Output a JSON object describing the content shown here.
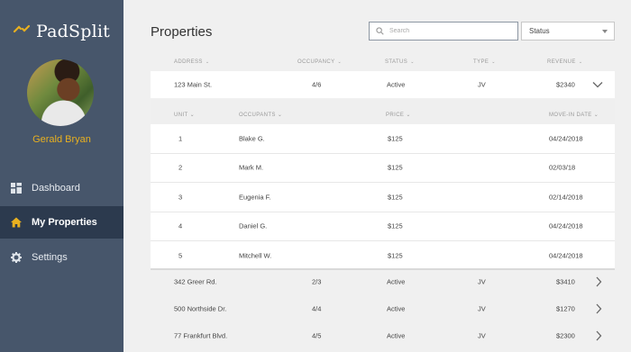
{
  "brand": {
    "name": "PadSplit",
    "accent": "#e8b020"
  },
  "user": {
    "name": "Gerald Bryan"
  },
  "nav": [
    {
      "label": "Dashboard",
      "icon": "dashboard-icon",
      "active": false
    },
    {
      "label": "My Properties",
      "icon": "home-icon",
      "active": true
    },
    {
      "label": "Settings",
      "icon": "gear-icon",
      "active": false
    }
  ],
  "page": {
    "title": "Properties"
  },
  "search": {
    "placeholder": "Search"
  },
  "status_filter": {
    "value": "Status"
  },
  "columns": {
    "address": "ADDRESS",
    "occupancy": "OCCUPANCY",
    "status": "STATUS",
    "type": "TYPE",
    "revenue": "REVENUE"
  },
  "sub_columns": {
    "unit": "UNIT",
    "occupants": "OCCUPANTS",
    "price": "PRICE",
    "move_in": "MOVE-IN DATE"
  },
  "properties": [
    {
      "address": "123 Main St.",
      "occupancy": "4/6",
      "status": "Active",
      "type": "JV",
      "revenue": "$2340",
      "expanded": true
    },
    {
      "address": "342 Greer Rd.",
      "occupancy": "2/3",
      "status": "Active",
      "type": "JV",
      "revenue": "$3410",
      "expanded": false
    },
    {
      "address": "500 Northside Dr.",
      "occupancy": "4/4",
      "status": "Active",
      "type": "JV",
      "revenue": "$1270",
      "expanded": false
    },
    {
      "address": "77 Frankfurt Blvd.",
      "occupancy": "4/5",
      "status": "Active",
      "type": "JV",
      "revenue": "$2300",
      "expanded": false
    }
  ],
  "units": [
    {
      "unit": "1",
      "occupant": "Blake G.",
      "price": "$125",
      "move_in": "04/24/2018"
    },
    {
      "unit": "2",
      "occupant": "Mark M.",
      "price": "$125",
      "move_in": "02/03/18"
    },
    {
      "unit": "3",
      "occupant": "Eugenia F.",
      "price": "$125",
      "move_in": "02/14/2018"
    },
    {
      "unit": "4",
      "occupant": "Daniel G.",
      "price": "$125",
      "move_in": "04/24/2018"
    },
    {
      "unit": "5",
      "occupant": "Mitchell W.",
      "price": "$125",
      "move_in": "04/24/2018"
    }
  ]
}
